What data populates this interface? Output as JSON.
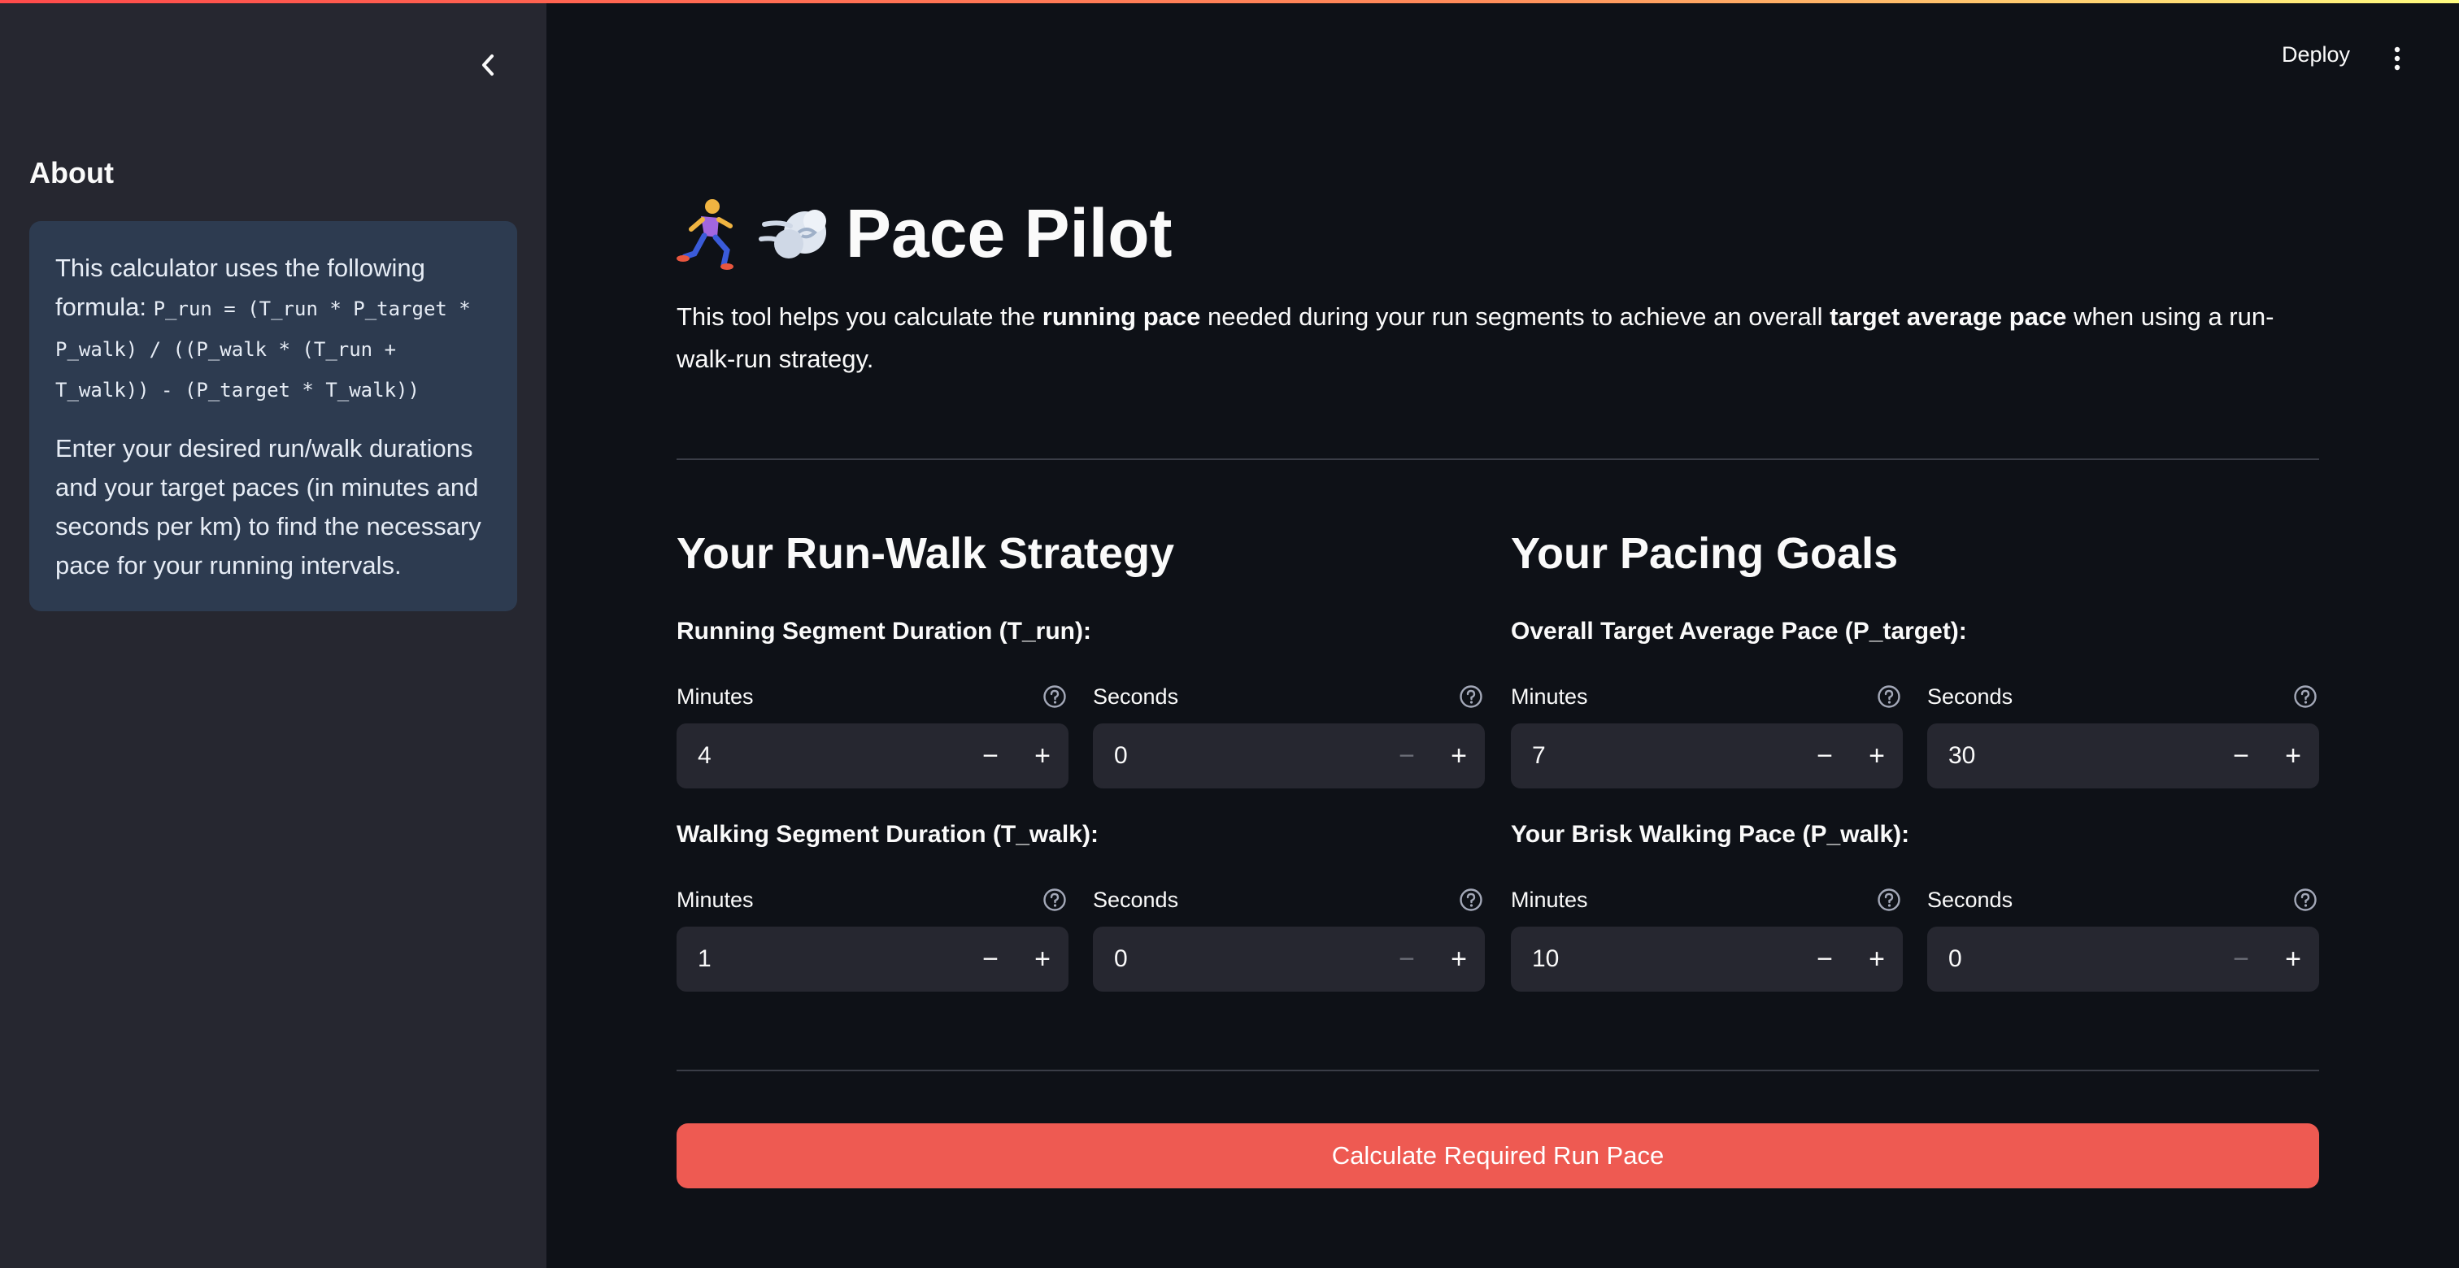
{
  "sidebar": {
    "title": "About",
    "info": {
      "line1_prefix": "This calculator uses the following formula: ",
      "formula": "P_run = (T_run * P_target * P_walk) / ((P_walk * (T_run + T_walk)) - (P_target * T_walk))",
      "paragraph2": "Enter your desired run/walk durations and your target paces (in minutes and seconds per km) to find the necessary pace for your running intervals."
    }
  },
  "header": {
    "deploy_label": "Deploy"
  },
  "main": {
    "title": "Pace Pilot",
    "title_icons": [
      "runner-emoji",
      "dash-cloud-emoji"
    ],
    "intro": {
      "p1": "This tool helps you calculate the ",
      "b1": "running pace",
      "p2": " needed during your run segments to achieve an overall ",
      "b2": "target average pace",
      "p3": " when using a run-walk-run strategy."
    },
    "strategy": {
      "heading": "Your Run-Walk Strategy",
      "run_label": "Running Segment Duration (T_run):",
      "run_minutes_label": "Minutes",
      "run_minutes_value": "4",
      "run_seconds_label": "Seconds",
      "run_seconds_value": "0",
      "walk_label": "Walking Segment Duration (T_walk):",
      "walk_minutes_label": "Minutes",
      "walk_minutes_value": "1",
      "walk_seconds_label": "Seconds",
      "walk_seconds_value": "0"
    },
    "goals": {
      "heading": "Your Pacing Goals",
      "target_label": "Overall Target Average Pace (P_target):",
      "target_minutes_label": "Minutes",
      "target_minutes_value": "7",
      "target_seconds_label": "Seconds",
      "target_seconds_value": "30",
      "walkpace_label": "Your Brisk Walking Pace (P_walk):",
      "walkpace_minutes_label": "Minutes",
      "walkpace_minutes_value": "10",
      "walkpace_seconds_label": "Seconds",
      "walkpace_seconds_value": "0"
    },
    "stepper": {
      "minus": "−",
      "plus": "+"
    },
    "calculate_button": "Calculate Required Run Pace"
  },
  "colors": {
    "background": "#0e1117",
    "sidebar": "#262730",
    "info_box": "#2d3b50",
    "primary_button": "#ee5a52"
  }
}
